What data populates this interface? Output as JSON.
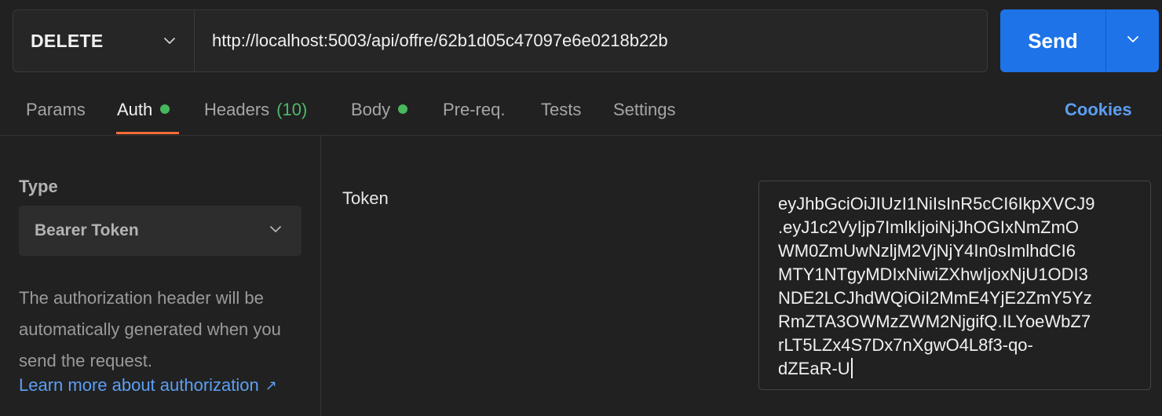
{
  "request": {
    "method": "DELETE",
    "url": "http://localhost:5003/api/offre/62b1d05c47097e6e0218b22b",
    "send_label": "Send"
  },
  "tabs": [
    {
      "label": "Params"
    },
    {
      "label": "Auth",
      "active": true,
      "dot": true
    },
    {
      "label": "Headers",
      "count": "(10)"
    },
    {
      "label": "Body",
      "dot": true
    },
    {
      "label": "Pre-req."
    },
    {
      "label": "Tests"
    },
    {
      "label": "Settings"
    }
  ],
  "cookies_label": "Cookies",
  "auth": {
    "type_label": "Type",
    "type_value": "Bearer Token",
    "help_text": "The authorization header will be automatically generated when you send the request.",
    "learn_more": "Learn more about authorization",
    "learn_more_icon": "external-link-arrow-icon",
    "token_label": "Token",
    "token_lines": [
      "eyJhbGciOiJIUzI1NiIsInR5cCI6IkpXVCJ9",
      ".eyJ1c2VyIjp7ImlkIjoiNjJhOGIxNmZmO",
      "WM0ZmUwNzljM2VjNjY4In0sImlhdCI6",
      "MTY1NTgyMDIxNiwiZXhwIjoxNjU1ODI3",
      "NDE2LCJhdWQiOiI2MmE4YjE2ZmY5Yz",
      "RmZTA3OWMzZWM2NjgifQ.ILYoeWbZ7",
      "rLT5LZx4S7Dx7nXgwO4L8f3-qo-",
      "dZEaR-U"
    ]
  },
  "colors": {
    "background": "#212121",
    "accent_send": "#1e73e8",
    "tab_underline": "#ff6c37",
    "link": "#5c9ff2",
    "status_dot": "#47b85c"
  }
}
